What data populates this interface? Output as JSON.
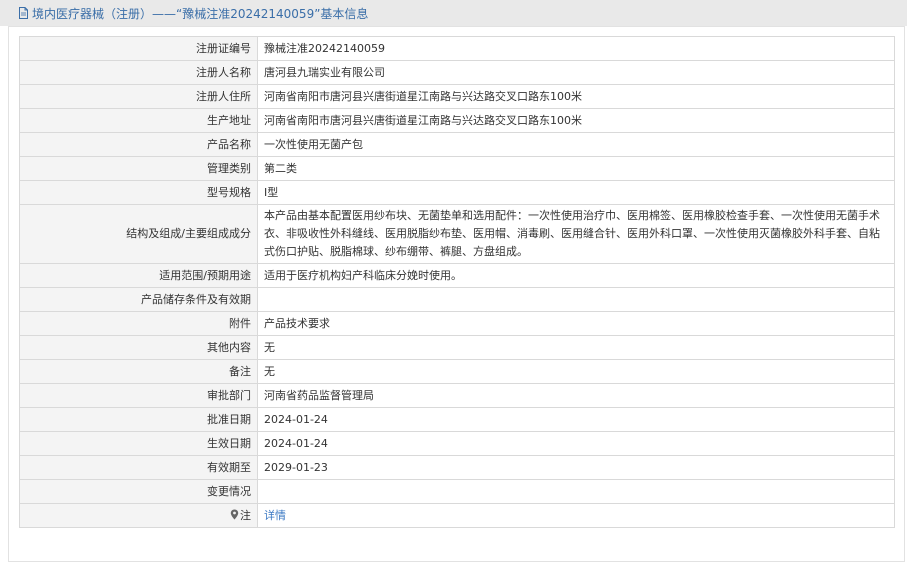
{
  "header": {
    "title": "境内医疗器械（注册）——“豫械注准20242140059”基本信息"
  },
  "rows": [
    {
      "label": "注册证编号",
      "value": "豫械注准20242140059"
    },
    {
      "label": "注册人名称",
      "value": "唐河县九瑞实业有限公司"
    },
    {
      "label": "注册人住所",
      "value": "河南省南阳市唐河县兴唐街道星江南路与兴达路交叉口路东100米"
    },
    {
      "label": "生产地址",
      "value": "河南省南阳市唐河县兴唐街道星江南路与兴达路交叉口路东100米"
    },
    {
      "label": "产品名称",
      "value": "一次性使用无菌产包"
    },
    {
      "label": "管理类别",
      "value": "第二类"
    },
    {
      "label": "型号规格",
      "value": "Ⅰ型"
    },
    {
      "label": "结构及组成/主要组成成分",
      "value": "本产品由基本配置医用纱布块、无菌垫单和选用配件：一次性使用治疗巾、医用棉签、医用橡胶检查手套、一次性使用无菌手术衣、非吸收性外科缝线、医用脱脂纱布垫、医用帽、消毒刷、医用缝合针、医用外科口罩、一次性使用灭菌橡胶外科手套、自粘式伤口护贴、脱脂棉球、纱布绷带、裤腿、方盘组成。"
    },
    {
      "label": "适用范围/预期用途",
      "value": "适用于医疗机构妇产科临床分娩时使用。"
    },
    {
      "label": "产品储存条件及有效期",
      "value": ""
    },
    {
      "label": "附件",
      "value": "产品技术要求"
    },
    {
      "label": "其他内容",
      "value": "无"
    },
    {
      "label": "备注",
      "value": "无"
    },
    {
      "label": "审批部门",
      "value": "河南省药品监督管理局"
    },
    {
      "label": "批准日期",
      "value": "2024-01-24"
    },
    {
      "label": "生效日期",
      "value": "2024-01-24"
    },
    {
      "label": "有效期至",
      "value": "2029-01-23"
    },
    {
      "label": "变更情况",
      "value": ""
    },
    {
      "label": "注",
      "value": "详情"
    }
  ],
  "icons": {
    "header": "document-icon",
    "note": "map-pin-icon"
  },
  "colors": {
    "header_bg": "#e9e9e9",
    "title": "#3a6ea8",
    "label_bg": "#f4f4f4",
    "border": "#d9d9d9",
    "link": "#3a78c3"
  }
}
